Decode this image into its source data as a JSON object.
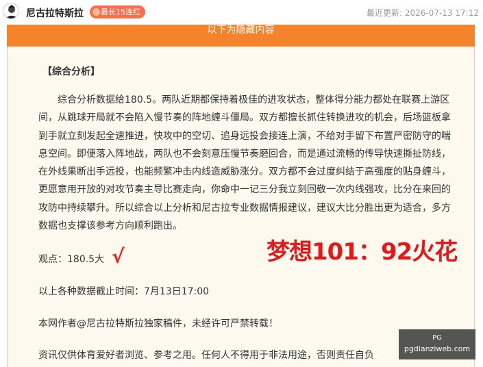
{
  "header": {
    "author_name": "尼古拉特斯拉",
    "streak_badge": "最长15连红",
    "updated_label": "最近更新:",
    "updated_time": "2026-07-13 17:12"
  },
  "content": {
    "hidden_bar_text": "以下为隐藏内容",
    "section_title": "【综合分析】",
    "analysis_lines": [
      "综合分析数据给180.5。两队近期都保持着极佳的进攻状态，整体得分能力都处在联赛上游区",
      "间，从跳球开局就不会陷入慢节奏的阵地缠斗僵局。双方都擅长抓住转换进攻的机会，后场篮板拿",
      "到手就立刻发起全速推进，快攻中的空切、追身远投会接连上演，不给对手留下布置严密防守的喘",
      "息空间。即便落入阵地战，两队也不会刻意压慢节奏磨回合，而是通过流畅的传导快速撕扯防线，",
      "在外线果断出手远投，也能频繁冲击内线造威胁涨分。双方都不会过度纠结于高强度的贴身缠斗，",
      "更愿意用开放的对攻节奏主导比赛走向，你命中一记三分我立刻回敬一次内线强攻，比分在来回的",
      "攻防中持续攀升。所以综合以上分析和尼古拉专业数据情报建议，建议大比分胜出更为适合，多方",
      "数据也支撑该参考方向顺利跑出。"
    ],
    "viewpoint": "观点：180.5大",
    "check_mark": "√",
    "overlay_text": "梦想101：92火花",
    "deadline": "以上各种数据截止时间：7月13日17:00",
    "copyright": "本网作者@尼古拉特斯拉独家稿件，未经许可严禁转载！",
    "disclaimer": "资讯仅供体育爱好者浏览、参考之用。任何人不得用于非法用途，否则责任自负"
  },
  "watermark": {
    "line1": "PG",
    "line2": "pgdianziweb.com"
  },
  "colors": {
    "accent_orange": "#f5832b",
    "badge": "#f86f4d",
    "box_bg": "#fef9ee",
    "overlay_red": "#e4181b"
  },
  "icons": {
    "avatar": "portrait-avatar",
    "badge_dot": "fire-icon"
  }
}
